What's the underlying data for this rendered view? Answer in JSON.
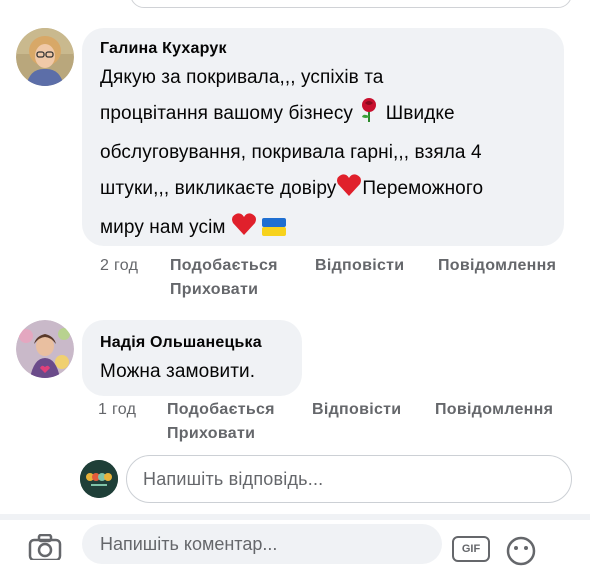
{
  "comments": [
    {
      "author": "Галина Кухарук",
      "lines": [
        "Дякую за покривала,,, успіхів та",
        "процвітання вашому бізнесу",
        "Швидке",
        "обслуговування, покривала гарні,,, взяла 4",
        "штуки,,, викликаєте довіру",
        "Переможного",
        "миру нам усім"
      ],
      "time": "2 год",
      "like": "Подобається",
      "reply": "Відповісти",
      "message": "Повідомлення",
      "hide": "Приховати"
    },
    {
      "author": "Надія Ольшанецька",
      "lines": [
        "Можна  замовити."
      ],
      "time": "1 год",
      "like": "Подобається",
      "reply": "Відповісти",
      "message": "Повідомлення",
      "hide": "Приховати"
    }
  ],
  "reply_box": {
    "placeholder": "Напишіть відповідь..."
  },
  "bottom_box": {
    "placeholder": "Напишіть коментар...",
    "gif": "GIF"
  },
  "icons": {
    "rose": "rose-emoji",
    "heart": "red-heart-emoji",
    "flag": "ukraine-flag-emoji"
  }
}
